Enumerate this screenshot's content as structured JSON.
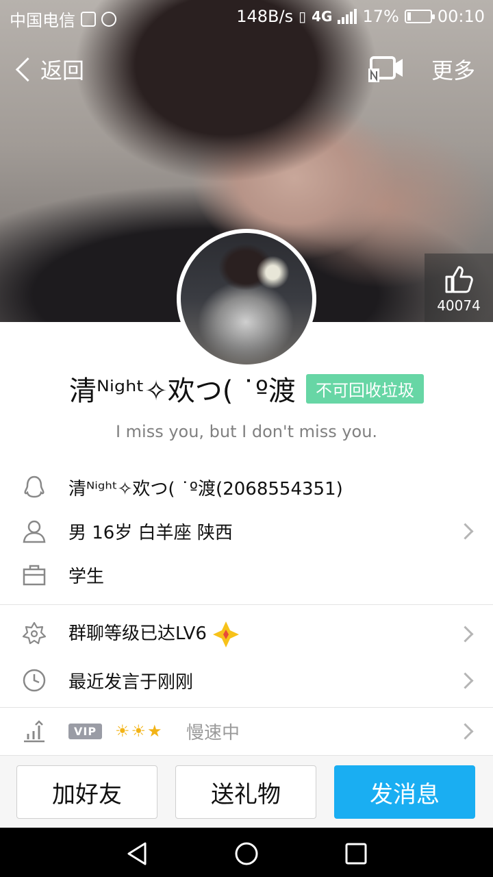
{
  "status_bar": {
    "carrier": "中国电信",
    "net_speed": "148B/s",
    "network": "4G",
    "battery": "17%",
    "battery_level": 0.17,
    "time": "00:10"
  },
  "nav": {
    "back_label": "返回",
    "more_label": "更多"
  },
  "likes": {
    "count": "40074"
  },
  "profile": {
    "nickname": "清ᴺⁱᵍʰᵗ✧欢つ( ˙º渡",
    "tag": "不可回收垃圾",
    "signature": "I miss you, but I don't miss you."
  },
  "info": {
    "qq_line": "清ᴺⁱᵍʰᵗ✧欢つ( ˙º渡(2068554351)",
    "basic_line": "男  16岁  白羊座  陕西",
    "job_line": "学生",
    "group_level": "群聊等级已达LV6",
    "last_speak": "最近发言于刚刚",
    "vip_badge": "VIP",
    "vip_status": "慢速中"
  },
  "actions": {
    "add_friend": "加好友",
    "send_gift": "送礼物",
    "send_message": "发消息"
  },
  "colors": {
    "accent_blue": "#1aaef2",
    "tag_green": "#67d6a5"
  }
}
